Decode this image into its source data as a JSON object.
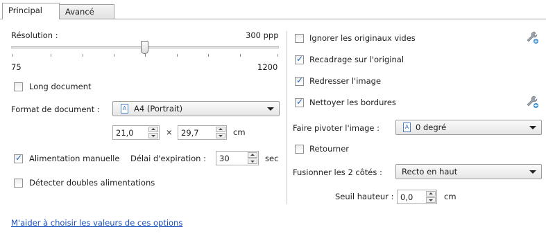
{
  "tabs": [
    {
      "label": "Principal",
      "active": true
    },
    {
      "label": "Avancé",
      "active": false
    }
  ],
  "resolution": {
    "label": "Résolution :",
    "value_text": "300 ppp",
    "min": "75",
    "max": "1200",
    "value": 300
  },
  "left": {
    "long_document": {
      "label": "Long document",
      "checked": false
    },
    "format": {
      "label": "Format de document :",
      "value": "A4 (Portrait)"
    },
    "size": {
      "width": "21,0",
      "times": "×",
      "height": "29,7",
      "unit": "cm"
    },
    "manual_feed": {
      "label": "Alimentation manuelle",
      "checked": true
    },
    "timeout": {
      "label": "Délai d'expiration :",
      "value": "30",
      "unit": "sec"
    },
    "double_feed": {
      "label": "Détecter doubles alimentations",
      "checked": false
    }
  },
  "right": {
    "ignore_blank": {
      "label": "Ignorer les originaux vides",
      "checked": false
    },
    "crop": {
      "label": "Recadrage sur l'original",
      "checked": true
    },
    "straighten": {
      "label": "Redresser l'image",
      "checked": true
    },
    "clean_borders": {
      "label": "Nettoyer les bordures",
      "checked": true
    },
    "rotate": {
      "label": "Faire pivoter l'image :",
      "value": "0 degré"
    },
    "flip": {
      "label": "Retourner",
      "checked": false
    },
    "merge": {
      "label": "Fusionner les 2 côtés :",
      "value": "Recto en haut"
    },
    "threshold": {
      "label": "Seuil hauteur :",
      "value": "0,0",
      "unit": "cm"
    }
  },
  "help_link": "M'aider à choisir les valeurs de ces options",
  "colors": {
    "accent": "#1d5fb4",
    "link": "#1a4fbf"
  },
  "icons": {
    "settings": "wrench-icon",
    "page": "page-icon"
  }
}
